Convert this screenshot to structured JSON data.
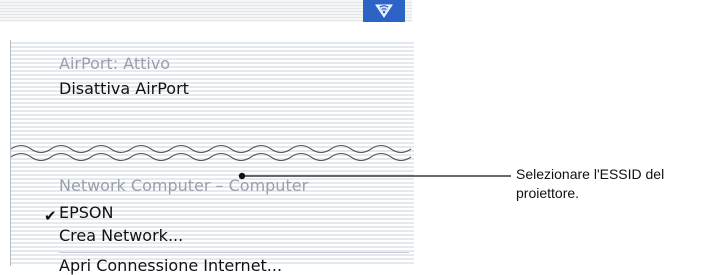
{
  "menu_bar": {
    "airport_icon": "airport-signal-icon"
  },
  "menu": {
    "airport_status": "AirPort: Attivo",
    "turn_off": "Disattiva AirPort",
    "network_header": "Network Computer – Computer",
    "selected_mark": "✔",
    "network_selected": "EPSON",
    "create_network": "Crea Network...",
    "open_internet_connection": "Apri Connessione Internet..."
  },
  "annotation": {
    "callout": "Selezionare l'ESSID del proiettore."
  },
  "colors": {
    "accent": "#2d62c6",
    "disabled_text": "#9aa0a8",
    "text": "#111111"
  }
}
